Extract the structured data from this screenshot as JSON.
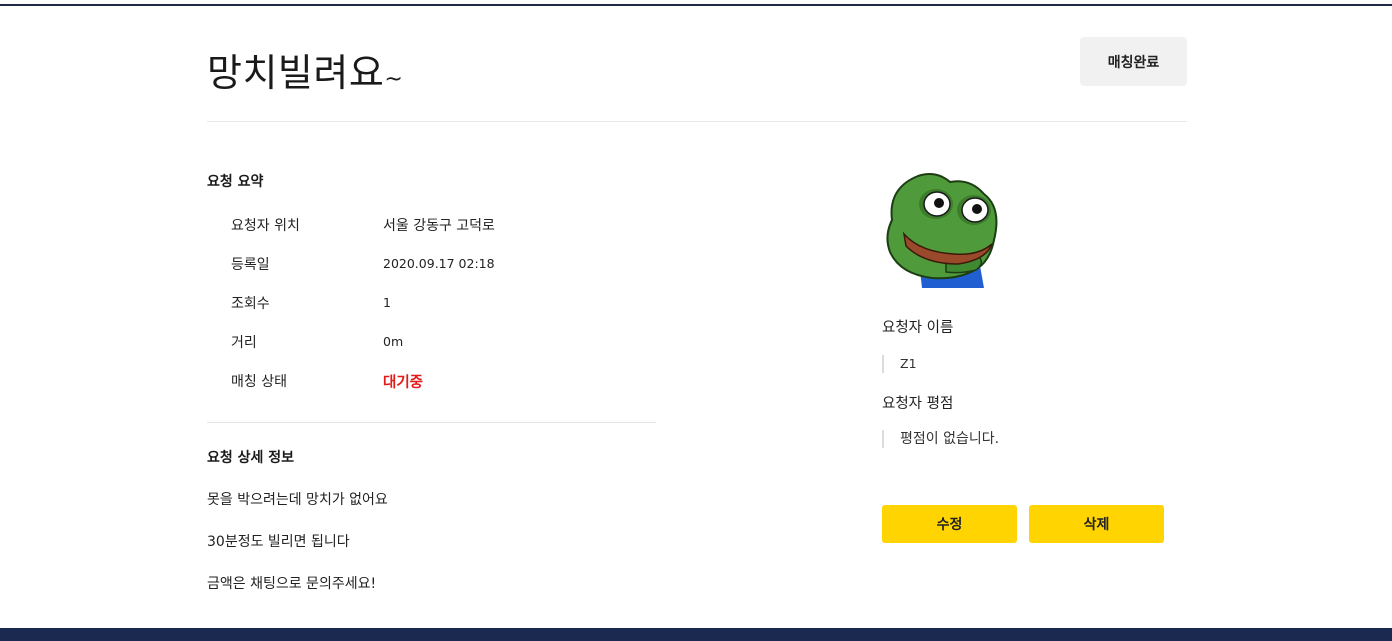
{
  "header": {
    "title": "망치빌려요",
    "title_suffix": "~",
    "complete_button_label": "매칭완료"
  },
  "summary": {
    "section_title": "요청 요약",
    "rows": [
      {
        "label": "요청자 위치",
        "value": "서울 강동구 고덕로"
      },
      {
        "label": "등록일",
        "value": "2020.09.17 02:18"
      },
      {
        "label": "조회수",
        "value": "1"
      },
      {
        "label": "거리",
        "value": "0m"
      },
      {
        "label": "매칭 상태",
        "value": "대기중"
      }
    ],
    "status_color": "#e31a1a"
  },
  "details": {
    "section_title": "요청 상세 정보",
    "lines": [
      "못을 박으려는데 망치가 없어요",
      "30분정도 빌리면 됩니다",
      "금액은 채팅으로 문의주세요!"
    ]
  },
  "requester": {
    "avatar_icon": "pepe-frog-avatar-icon",
    "name_label": "요청자 이름",
    "name_value": "Z1",
    "rating_label": "요청자 평점",
    "rating_value": "평점이 없습니다."
  },
  "actions": {
    "edit_label": "수정",
    "delete_label": "삭제",
    "button_color": "#ffd400"
  },
  "colors": {
    "top_bar": "#1f2a44",
    "bottom_bar": "#1b2950"
  }
}
